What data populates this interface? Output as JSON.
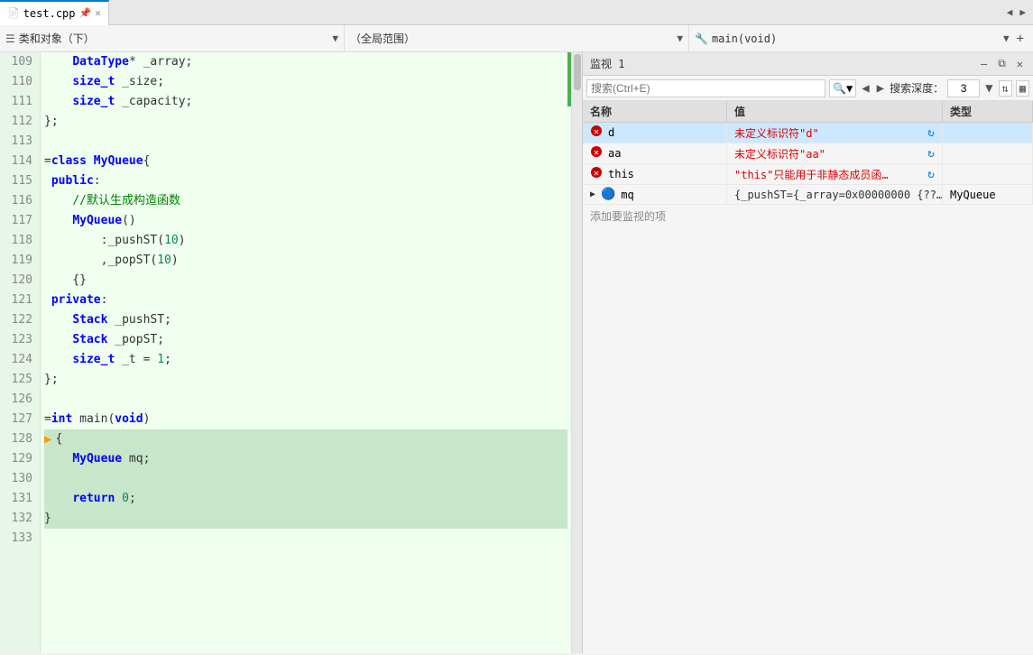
{
  "tab": {
    "filename": "test.cpp",
    "icon": "📄",
    "close_label": "✕"
  },
  "tab_arrows": {
    "left": "◀",
    "right": "▶"
  },
  "toolbar": {
    "segment1": {
      "icon": "☰",
      "label": "类和对象（下）",
      "dropdown": "▼"
    },
    "segment2": {
      "label": "（全局范围）",
      "dropdown": "▼"
    },
    "segment3": {
      "icon": "🔧",
      "label": "main(void)",
      "dropdown": "▼",
      "add": "+"
    }
  },
  "code": {
    "lines": [
      {
        "num": "109",
        "text": "    DataType* _array;",
        "highlight": false
      },
      {
        "num": "110",
        "text": "    size_t _size;",
        "highlight": false
      },
      {
        "num": "111",
        "text": "    size_t _capacity;",
        "highlight": false
      },
      {
        "num": "112",
        "text": "};",
        "highlight": false
      },
      {
        "num": "113",
        "text": "",
        "highlight": false
      },
      {
        "num": "114",
        "text": "=class MyQueue{",
        "highlight": false
      },
      {
        "num": "115",
        "text": " public:",
        "highlight": false
      },
      {
        "num": "116",
        "text": "    //默认生成构造函数",
        "highlight": false
      },
      {
        "num": "117",
        "text": "    MyQueue()",
        "highlight": false
      },
      {
        "num": "118",
        "text": "        :_pushST(10)",
        "highlight": false
      },
      {
        "num": "119",
        "text": "        ,_popST(10)",
        "highlight": false
      },
      {
        "num": "120",
        "text": "    {}",
        "highlight": false
      },
      {
        "num": "121",
        "text": " private:",
        "highlight": false
      },
      {
        "num": "122",
        "text": "    Stack _pushST;",
        "highlight": false
      },
      {
        "num": "123",
        "text": "    Stack _popST;",
        "highlight": false
      },
      {
        "num": "124",
        "text": "    size_t _t = 1;",
        "highlight": false
      },
      {
        "num": "125",
        "text": "};",
        "highlight": false
      },
      {
        "num": "126",
        "text": "",
        "highlight": false
      },
      {
        "num": "127",
        "text": "=int main(void)",
        "highlight": false
      },
      {
        "num": "128",
        "text": "{",
        "highlight": true,
        "debug": true
      },
      {
        "num": "129",
        "text": "    MyQueue mq;",
        "highlight": true
      },
      {
        "num": "130",
        "text": "",
        "highlight": true
      },
      {
        "num": "131",
        "text": "    return 0;",
        "highlight": true
      },
      {
        "num": "132",
        "text": "}",
        "highlight": true
      },
      {
        "num": "133",
        "text": "",
        "highlight": false
      }
    ]
  },
  "watch_panel": {
    "title": "监视 1",
    "close_btn": "✕",
    "float_btn": "⧉",
    "dock_btn": "—",
    "toolbar": {
      "search_placeholder": "搜索(Ctrl+E)",
      "search_icon": "🔍",
      "prev_btn": "◀",
      "next_btn": "▶",
      "depth_label": "搜索深度：",
      "depth_value": "3",
      "sort_btn": "⇅",
      "view_btn": "▦"
    },
    "columns": {
      "name": "名称",
      "value": "值",
      "type": "类型"
    },
    "rows": [
      {
        "name": "d",
        "value": "未定义标识符\"d\"",
        "type": "",
        "status": "error",
        "refresh": true,
        "selected": true
      },
      {
        "name": "aa",
        "value": "未定义标识符\"aa\"",
        "type": "",
        "status": "error",
        "refresh": true,
        "selected": false
      },
      {
        "name": "this",
        "value": "\"this\"只能用于非静态成员函…",
        "type": "",
        "status": "error",
        "refresh": true,
        "selected": false
      },
      {
        "name": "mq",
        "value": "{_pushST={_array=0x00000000 {??…",
        "type": "MyQueue",
        "status": "object",
        "refresh": false,
        "expandable": true,
        "selected": false
      }
    ],
    "add_label": "添加要监视的项"
  }
}
